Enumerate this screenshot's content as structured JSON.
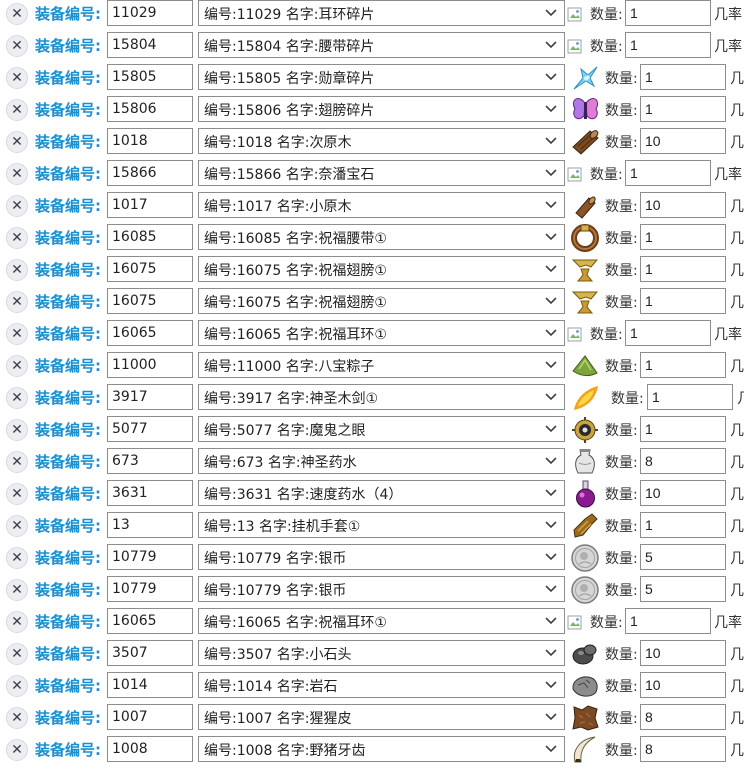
{
  "labels": {
    "equip": "装备编号:",
    "qty": "数量:",
    "extra": "几率"
  },
  "delete_glyph": "✕",
  "rows": [
    {
      "id": "11029",
      "option": "编号:11029 名字:耳环碎片",
      "icon": "broken-image-icon",
      "qty": "1"
    },
    {
      "id": "15804",
      "option": "编号:15804 名字:腰带碎片",
      "icon": "broken-image-icon",
      "qty": "1"
    },
    {
      "id": "15805",
      "option": "编号:15805 名字:勋章碎片",
      "icon": "crystal-shard-icon",
      "qty": "1"
    },
    {
      "id": "15806",
      "option": "编号:15806 名字:翅膀碎片",
      "icon": "butterfly-wing-icon",
      "qty": "1"
    },
    {
      "id": "1018",
      "option": "编号:1018 名字:次原木",
      "icon": "log-icon",
      "qty": "10"
    },
    {
      "id": "15866",
      "option": "编号:15866 名字:奈潘宝石",
      "icon": "broken-image-icon",
      "qty": "1"
    },
    {
      "id": "1017",
      "option": "编号:1017 名字:小原木",
      "icon": "small-log-icon",
      "qty": "10"
    },
    {
      "id": "16085",
      "option": "编号:16085 名字:祝福腰带①",
      "icon": "belt-icon",
      "qty": "1"
    },
    {
      "id": "16075",
      "option": "编号:16075 名字:祝福翅膀①",
      "icon": "golden-wing-icon",
      "qty": "1"
    },
    {
      "id": "16075",
      "option": "编号:16075 名字:祝福翅膀①",
      "icon": "golden-wing-icon",
      "qty": "1"
    },
    {
      "id": "16065",
      "option": "编号:16065 名字:祝福耳环①",
      "icon": "broken-image-icon",
      "qty": "1"
    },
    {
      "id": "11000",
      "option": "编号:11000 名字:八宝粽子",
      "icon": "rice-dumpling-icon",
      "qty": "1"
    },
    {
      "id": "3917",
      "option": "编号:3917 名字:神圣木剑①",
      "icon": "flame-sword-icon",
      "qty": "1"
    },
    {
      "id": "5077",
      "option": "编号:5077 名字:魔鬼之眼",
      "icon": "demon-eye-icon",
      "qty": "1"
    },
    {
      "id": "673",
      "option": "编号:673 名字:神圣药水",
      "icon": "potion-jar-icon",
      "qty": "8"
    },
    {
      "id": "3631",
      "option": "编号:3631 名字:速度药水（4）",
      "icon": "purple-potion-icon",
      "qty": "10"
    },
    {
      "id": "13",
      "option": "编号:13 名字:挂机手套①",
      "icon": "glove-icon",
      "qty": "1"
    },
    {
      "id": "10779",
      "option": "编号:10779 名字:银币",
      "icon": "silver-coin-icon",
      "qty": "5"
    },
    {
      "id": "10779",
      "option": "编号:10779 名字:银币",
      "icon": "silver-coin-icon",
      "qty": "5"
    },
    {
      "id": "16065",
      "option": "编号:16065 名字:祝福耳环①",
      "icon": "broken-image-icon",
      "qty": "1"
    },
    {
      "id": "3507",
      "option": "编号:3507 名字:小石头",
      "icon": "pebble-icon",
      "qty": "10"
    },
    {
      "id": "1014",
      "option": "编号:1014 名字:岩石",
      "icon": "rock-icon",
      "qty": "10"
    },
    {
      "id": "1007",
      "option": "编号:1007 名字:猩猩皮",
      "icon": "hide-icon",
      "qty": "8"
    },
    {
      "id": "1008",
      "option": "编号:1008 名字:野猪牙齿",
      "icon": "tusk-icon",
      "qty": "8"
    }
  ]
}
